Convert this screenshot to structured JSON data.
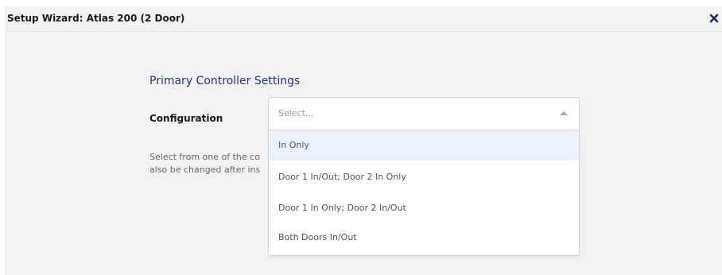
{
  "dialog": {
    "title": "Setup Wizard: Atlas 200 (2 Door)",
    "close_icon": "close-icon"
  },
  "section": {
    "title": "Primary Controller Settings"
  },
  "configuration": {
    "label": "Configuration",
    "placeholder": "Select...",
    "options": [
      "In Only",
      "Door 1 In/Out; Door 2 In Only",
      "Door 1 In Only; Door 2 In/Out",
      "Both Doors In/Out"
    ],
    "highlighted_option": "In Only",
    "help_line1": "Select from one of the co",
    "help_line2": "also be changed after ins"
  },
  "colors": {
    "dialog_bg": "#f2f2f2",
    "section_title": "#24337a",
    "option_highlight": "#eaf1fb"
  }
}
